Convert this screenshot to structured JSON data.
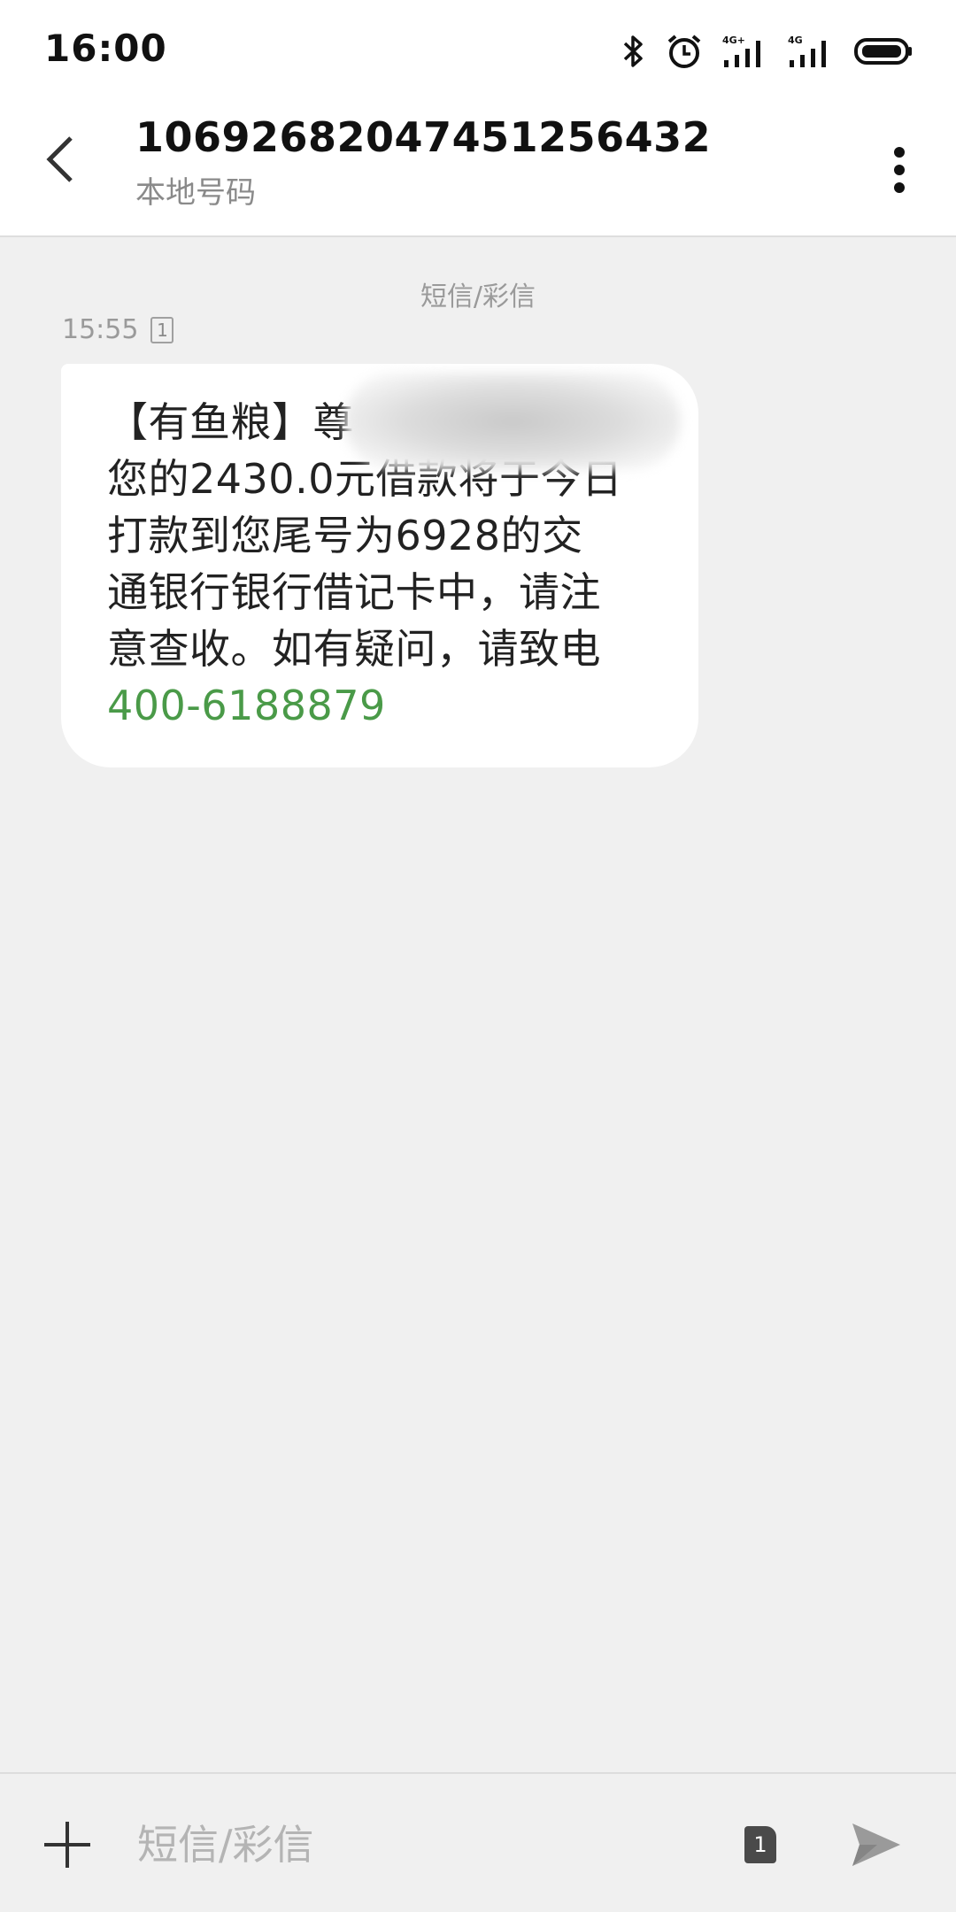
{
  "status_bar": {
    "time": "16:00",
    "sim1_network": "4G+",
    "sim2_network": "4G",
    "icons": [
      "bluetooth-icon",
      "alarm-icon",
      "signal-icon",
      "signal-icon",
      "battery-icon"
    ]
  },
  "header": {
    "contact_number": "1069268204745125643​2",
    "contact_subtitle": "本地号码",
    "back_icon": "back-arrow-icon",
    "more_icon": "more-vertical-icon"
  },
  "conversation": {
    "channel_label": "短信/彩信",
    "messages": [
      {
        "time": "15:55",
        "sim_slot": "1",
        "lines": [
          "【有鱼粮】尊",
          "您的2430.0元借款将于今日",
          "打款到您尾号为6928的交",
          "通银行银行借记卡中，请注",
          "意查收。如有疑问，请致电"
        ],
        "phone": "400-6188879"
      }
    ]
  },
  "composer": {
    "placeholder": "短信/彩信",
    "value": "",
    "sim_slot": "1",
    "attach_icon": "plus-icon",
    "send_icon": "send-icon"
  },
  "colors": {
    "link_green": "#4a9a48",
    "background": "#f0f0f0",
    "bubble": "#ffffff"
  }
}
